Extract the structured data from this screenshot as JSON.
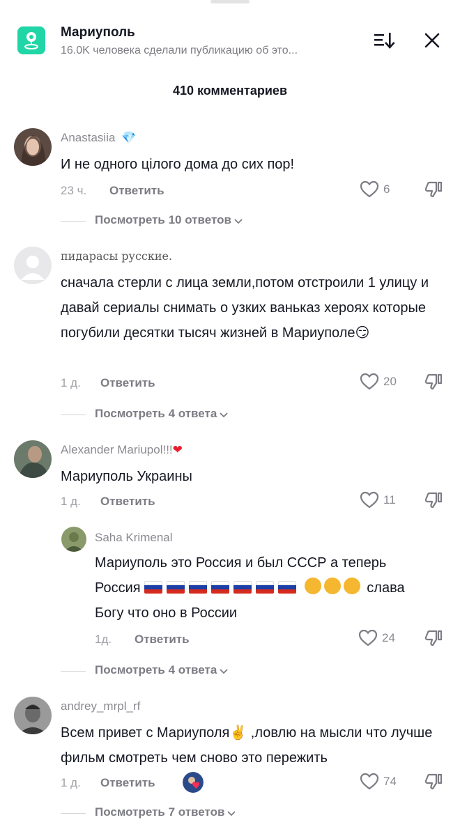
{
  "header": {
    "title": "Мариуполь",
    "subtitle": "16.0K человека сделали публикацию об это...",
    "comment_count": "410 комментариев"
  },
  "colors": {
    "accent": "#20d5a6",
    "text": "#161823",
    "muted": "#8a8b91"
  },
  "icons": [
    "location-pin-icon",
    "sort-icon",
    "close-icon",
    "heart-icon",
    "dislike-icon",
    "chevron-down-icon",
    "gem-icon",
    "red-heart-icon"
  ],
  "comments": [
    {
      "username": "Anastasiia",
      "badge": "💎",
      "text": "И не одного цілого дома до сих пор!",
      "time": "23 ч.",
      "reply_label": "Ответить",
      "likes": "6",
      "view_replies": "Посмотреть 10 ответов"
    },
    {
      "username": "пидарасы русские.",
      "text": "сначала стерли с лица земли,потом отстроили 1 улицу и давай сериалы снимать о узких ваньказ хероях которые погубили десятки тысяч жизней в Мариуполе😏",
      "time": "1 д.",
      "reply_label": "Ответить",
      "likes": "20",
      "view_replies": "Посмотреть 4 ответа"
    },
    {
      "username": "Alexander Mariupol!!!",
      "text": "Мариуполь Украины",
      "time": "1 д.",
      "reply_label": "Ответить",
      "likes": "11"
    },
    {
      "username": "Saha Krimenal",
      "text_line1": "Мариуполь это Россия и был СССР а теперь",
      "text_line2_start": "Россия",
      "text_line2_end": "слава",
      "text_line3": "Богу что оно в России",
      "time": "1д.",
      "reply_label": "Ответить",
      "likes": "24",
      "view_replies": "Посмотреть 4 ответа"
    },
    {
      "username": "andrey_mrpl_rf",
      "text": "Всем привет с Мариуполя✌️ ,ловлю на мысли что лучше фильм смотреть чем сново это пережить",
      "time": "1 д.",
      "reply_label": "Ответить",
      "likes": "74",
      "view_replies": "Посмотреть 7 ответов"
    }
  ]
}
